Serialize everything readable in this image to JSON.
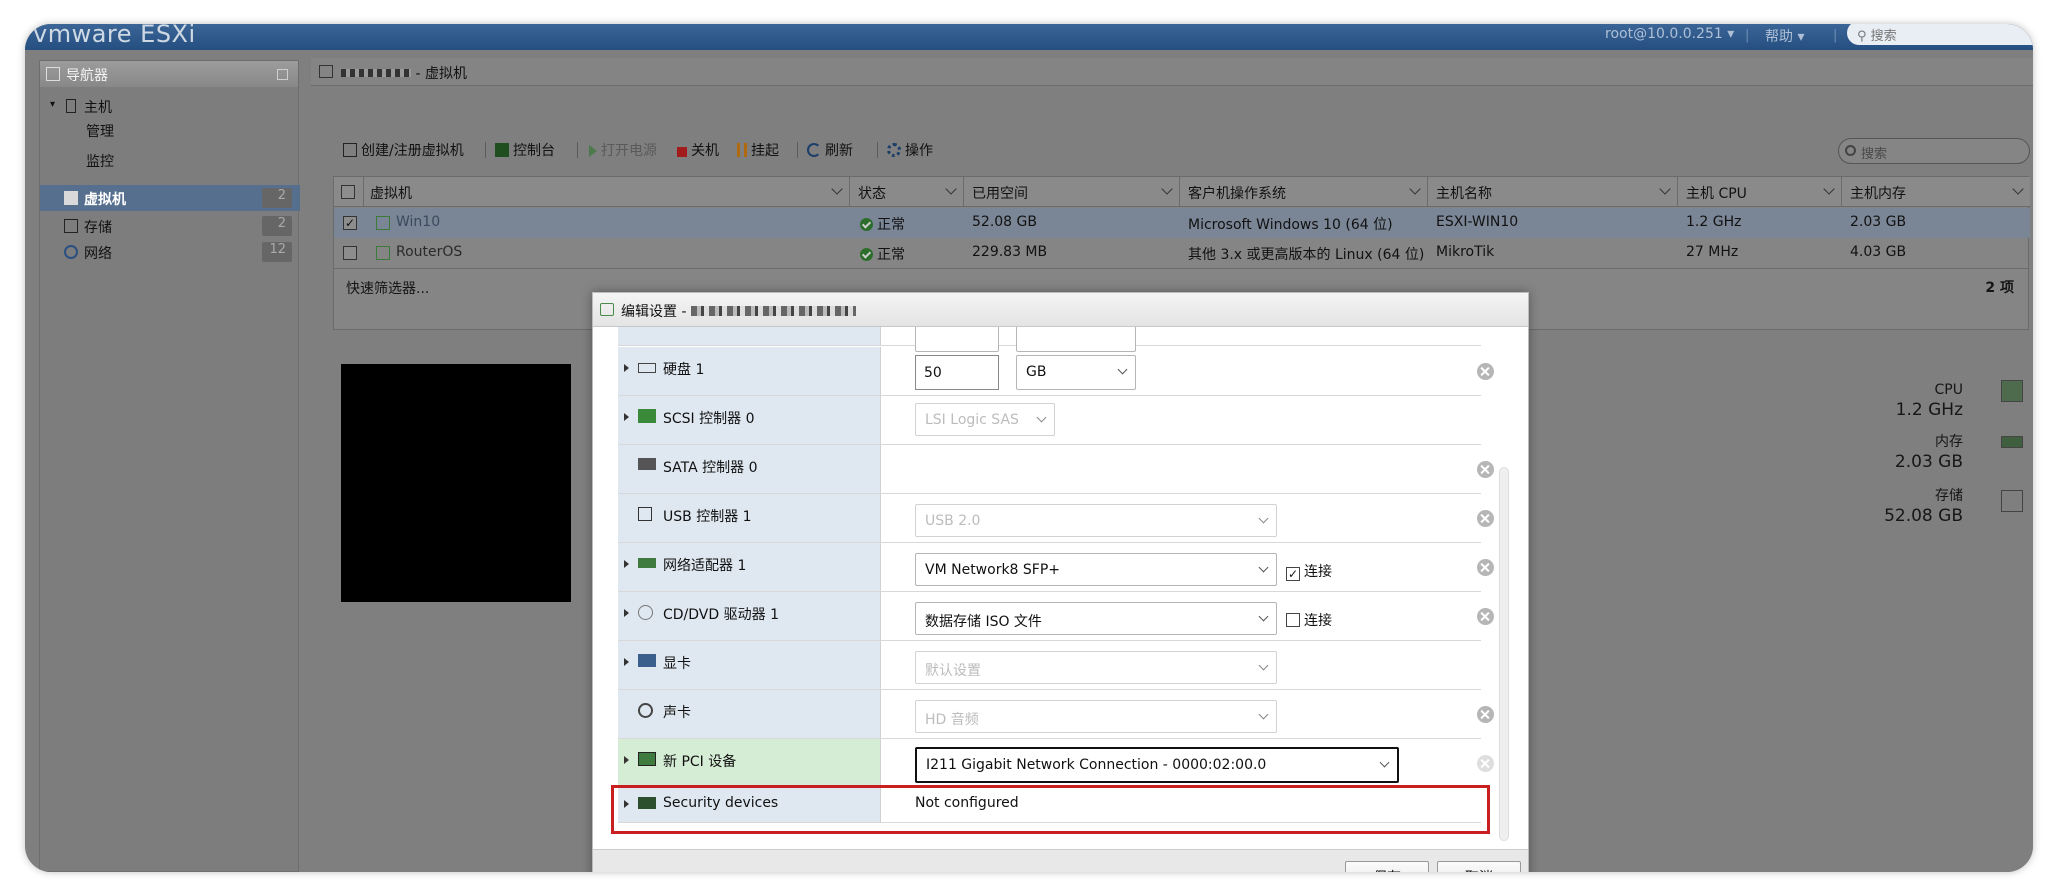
{
  "topbar": {
    "logo": "vmware ESXi",
    "user": "root@10.0.0.251 ▾",
    "help": "帮助 ▾",
    "search_placeholder": "搜索"
  },
  "navigator": {
    "title": "导航器",
    "host": "主机",
    "host_children": [
      "管理",
      "监控"
    ],
    "items": [
      {
        "label": "虚拟机",
        "count": "2",
        "icon": "vm-icon",
        "active": true
      },
      {
        "label": "存储",
        "count": "2",
        "icon": "storage-icon"
      },
      {
        "label": "网络",
        "count": "12",
        "icon": "network-icon"
      }
    ]
  },
  "main": {
    "breadcrumb": "- 虚拟机",
    "toolbar": {
      "create": "创建/注册虚拟机",
      "console": "控制台",
      "power_on": "打开电源",
      "power_off": "关机",
      "suspend": "挂起",
      "refresh": "刷新",
      "actions": "操作"
    },
    "search_placeholder": "搜索",
    "columns": [
      "虚拟机",
      "状态",
      "已用空间",
      "客户机操作系统",
      "主机名称",
      "主机 CPU",
      "主机内存"
    ],
    "rows": [
      {
        "name": "Win10",
        "status": "正常",
        "used": "52.08 GB",
        "os": "Microsoft Windows 10 (64 位)",
        "hostname": "ESXI-WIN10",
        "cpu": "1.2 GHz",
        "mem": "2.03 GB",
        "checked": "✓"
      },
      {
        "name": "RouterOS",
        "status": "正常",
        "used": "229.83 MB",
        "os": "其他 3.x 或更高版本的 Linux (64 位)",
        "hostname": "MikroTik",
        "cpu": "27 MHz",
        "mem": "4.03 GB",
        "checked": ""
      }
    ],
    "filter_label": "快速筛选器...",
    "item_count": "2 项",
    "resources": {
      "cpu_label": "CPU",
      "cpu_value": "1.2 GHz",
      "mem_label": "内存",
      "mem_value": "2.03 GB",
      "storage_label": "存储",
      "storage_value": "52.08 GB"
    }
  },
  "dialog": {
    "title": "编辑设置 -",
    "devices": [
      {
        "label": "硬盘 1",
        "value": "50",
        "unit": "GB",
        "icon": "disk-icon"
      },
      {
        "label": "SCSI 控制器 0",
        "value": "LSI Logic SAS",
        "icon": "scsi-icon"
      },
      {
        "label": "SATA 控制器 0",
        "icon": "sata-icon"
      },
      {
        "label": "USB 控制器 1",
        "value": "USB 2.0",
        "icon": "usb-icon"
      },
      {
        "label": "网络适配器 1",
        "value": "VM Network8 SFP+",
        "connect": "连接",
        "connected": "✓",
        "icon": "nic-icon"
      },
      {
        "label": "CD/DVD 驱动器 1",
        "value": "数据存储 ISO 文件",
        "connect": "连接",
        "connected": "",
        "icon": "cd-icon"
      },
      {
        "label": "显卡",
        "value": "默认设置",
        "icon": "display-icon"
      },
      {
        "label": "声卡",
        "value": "HD 音频",
        "icon": "sound-icon"
      },
      {
        "label": "新 PCI 设备",
        "value": "I211 Gigabit Network Connection - 0000:02:00.0",
        "icon": "pci-icon"
      },
      {
        "label": "Security devices",
        "value": "Not configured",
        "icon": "security-icon"
      }
    ],
    "save": "保存",
    "cancel": "取消"
  },
  "colors": {
    "highlight": "#c8201f",
    "topbar": "#2c5586",
    "active_nav": "#576f8e"
  }
}
